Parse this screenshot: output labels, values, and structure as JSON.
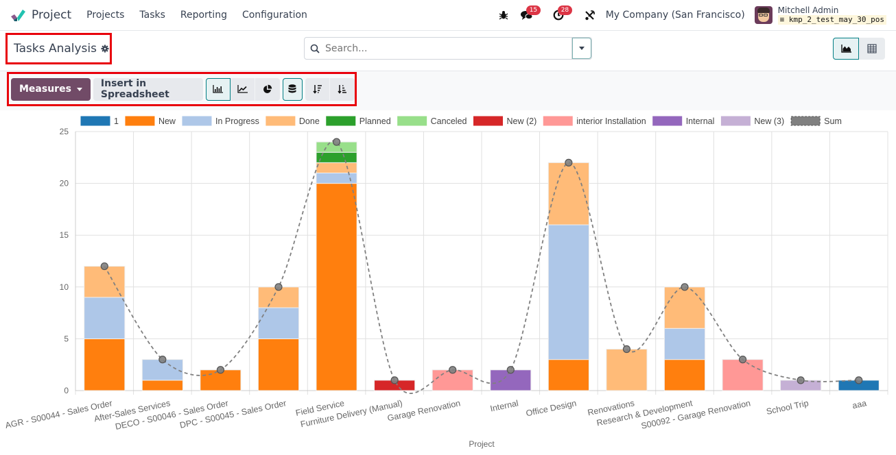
{
  "navbar": {
    "app_name": "Project",
    "menu": [
      "Projects",
      "Tasks",
      "Reporting",
      "Configuration"
    ],
    "messages_count": "15",
    "activities_count": "28",
    "company": "My Company (San Francisco)",
    "user_name": "Mitchell Admin",
    "database": "kmp_2_test_may_30_pos"
  },
  "control_panel": {
    "title": "Tasks Analysis",
    "search_placeholder": "Search...",
    "views": [
      "graph",
      "pivot"
    ]
  },
  "toolbar": {
    "measures_label": "Measures",
    "insert_label": "Insert in Spreadsheet",
    "chart_types": [
      "bar",
      "line",
      "pie"
    ],
    "active_chart_type": "bar",
    "stacked": true
  },
  "colors": {
    "brand": "#714b67",
    "accent": "#017e84",
    "highlight_box": "#e8000b"
  },
  "chart_data": {
    "type": "bar",
    "stacked": true,
    "xlabel": "Project",
    "ylabel": "",
    "ylim": [
      0,
      25
    ],
    "yticks": [
      0,
      5,
      10,
      15,
      20,
      25
    ],
    "grid": true,
    "legend_position": "top",
    "categories": [
      "AGR - S00044 - Sales Order",
      "After-Sales Services",
      "DECO - S00046 - Sales Order",
      "DPC - S00045 - Sales Order",
      "Field Service",
      "Furniture Delivery (Manual)",
      "Garage Renovation",
      "Internal",
      "Office Design",
      "Renovations",
      "Research & Development",
      "S00092 - Garage Renovation",
      "School Trip",
      "aaa"
    ],
    "series": [
      {
        "name": "1",
        "color": "#1f77b4",
        "values": [
          0,
          0,
          0,
          0,
          0,
          0,
          0,
          0,
          0,
          0,
          0,
          0,
          0,
          1
        ]
      },
      {
        "name": "New",
        "color": "#ff7f0e",
        "values": [
          5,
          1,
          2,
          5,
          20,
          0,
          0,
          0,
          3,
          0,
          3,
          0,
          0,
          0
        ]
      },
      {
        "name": "In Progress",
        "color": "#aec7e8",
        "values": [
          4,
          2,
          0,
          3,
          1,
          0,
          0,
          0,
          13,
          0,
          3,
          0,
          0,
          0
        ]
      },
      {
        "name": "Done",
        "color": "#ffbb78",
        "values": [
          3,
          0,
          0,
          2,
          1,
          0,
          0,
          0,
          6,
          4,
          4,
          0,
          0,
          0
        ]
      },
      {
        "name": "Planned",
        "color": "#2ca02c",
        "values": [
          0,
          0,
          0,
          0,
          1,
          0,
          0,
          0,
          0,
          0,
          0,
          0,
          0,
          0
        ]
      },
      {
        "name": "Canceled",
        "color": "#98df8a",
        "values": [
          0,
          0,
          0,
          0,
          1,
          0,
          0,
          0,
          0,
          0,
          0,
          0,
          0,
          0
        ]
      },
      {
        "name": "New (2)",
        "color": "#d62728",
        "values": [
          0,
          0,
          0,
          0,
          0,
          1,
          0,
          0,
          0,
          0,
          0,
          0,
          0,
          0
        ]
      },
      {
        "name": "interior Installation",
        "color": "#ff9896",
        "values": [
          0,
          0,
          0,
          0,
          0,
          0,
          2,
          0,
          0,
          0,
          0,
          3,
          0,
          0
        ]
      },
      {
        "name": "Internal",
        "color": "#9467bd",
        "values": [
          0,
          0,
          0,
          0,
          0,
          0,
          0,
          2,
          0,
          0,
          0,
          0,
          0,
          0
        ]
      },
      {
        "name": "New (3)",
        "color": "#c5b0d5",
        "values": [
          0,
          0,
          0,
          0,
          0,
          0,
          0,
          0,
          0,
          0,
          0,
          0,
          1,
          0
        ]
      }
    ],
    "sum_series": {
      "name": "Sum",
      "style": "dashed-line",
      "color": "#808080",
      "values": [
        12,
        3,
        2,
        10,
        24,
        1,
        2,
        2,
        22,
        4,
        10,
        3,
        1,
        1
      ]
    }
  }
}
